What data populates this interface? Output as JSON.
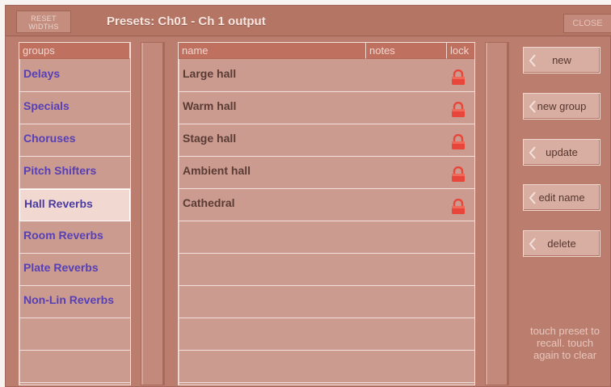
{
  "toolbar": {
    "reset_widths_label": "RESET\nWIDTHS",
    "title": "Presets: Ch01 - Ch 1 output",
    "close_label": "CLOSE"
  },
  "groups": {
    "header": "groups",
    "items": [
      {
        "label": "Delays"
      },
      {
        "label": "Specials"
      },
      {
        "label": "Choruses"
      },
      {
        "label": "Pitch Shifters"
      },
      {
        "label": "Hall Reverbs",
        "selected": true
      },
      {
        "label": "Room Reverbs"
      },
      {
        "label": "Plate Reverbs"
      },
      {
        "label": "Non-Lin Reverbs"
      },
      {
        "label": ""
      },
      {
        "label": ""
      }
    ]
  },
  "presets": {
    "headers": {
      "name": "name",
      "notes": "notes",
      "lock": "lock"
    },
    "items": [
      {
        "name": "Large hall",
        "locked": true
      },
      {
        "name": "Warm hall",
        "locked": true
      },
      {
        "name": "Stage hall",
        "locked": true
      },
      {
        "name": "Ambient hall",
        "locked": true
      },
      {
        "name": "Cathedral",
        "locked": true
      },
      {
        "name": "",
        "locked": false
      },
      {
        "name": "",
        "locked": false
      },
      {
        "name": "",
        "locked": false
      },
      {
        "name": "",
        "locked": false
      },
      {
        "name": "",
        "locked": false
      }
    ]
  },
  "actions": {
    "new": "new",
    "new_group": "new group",
    "update": "update",
    "edit_name": "edit name",
    "delete": "delete"
  },
  "hint": "touch preset to recall. touch again to clear",
  "colors": {
    "window_bg": "#bb7e6e",
    "panel_bg": "#cb9b8f",
    "header_bg": "#c0705f",
    "group_text": "#5740b6",
    "lock_icon": "#e8463a"
  }
}
